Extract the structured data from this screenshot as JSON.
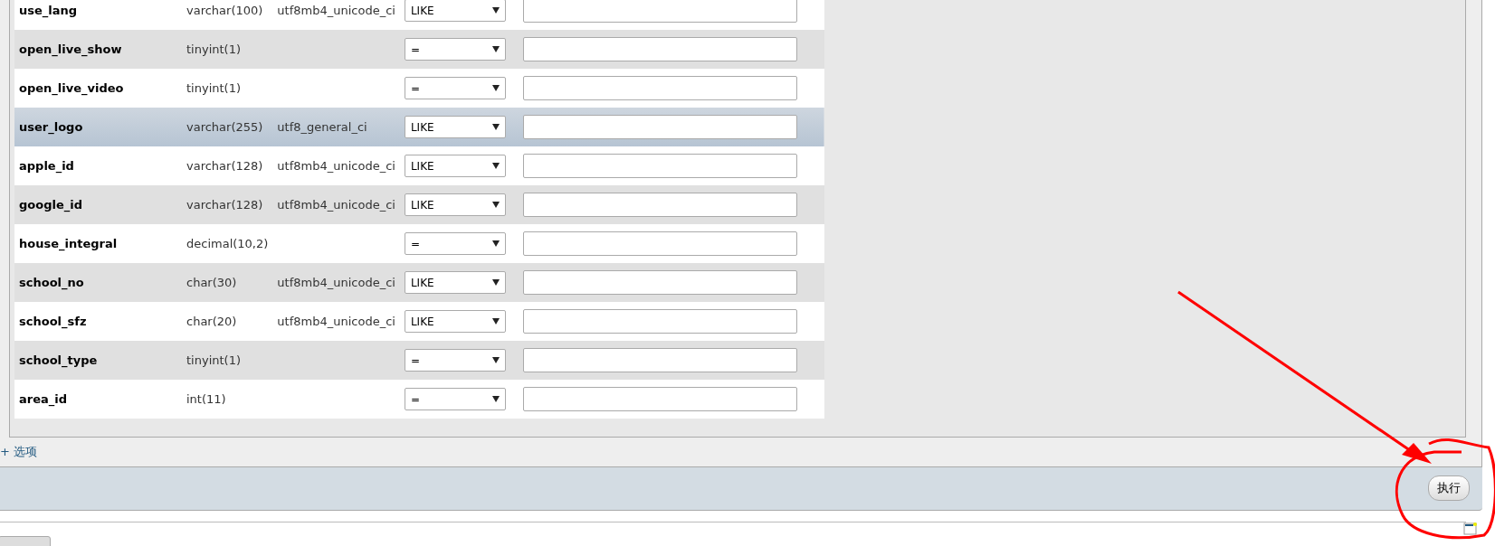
{
  "rows": [
    {
      "column": "use_lang",
      "type": "varchar(100)",
      "collation": "utf8mb4_unicode_ci",
      "operator": "LIKE",
      "highlighted": false
    },
    {
      "column": "open_live_show",
      "type": "tinyint(1)",
      "operator": "=",
      "highlighted": false
    },
    {
      "column": "open_live_video",
      "type": "tinyint(1)",
      "operator": "=",
      "highlighted": false
    },
    {
      "column": "user_logo",
      "type": "varchar(255)",
      "collation": "utf8_general_ci",
      "operator": "LIKE",
      "highlighted": true
    },
    {
      "column": "apple_id",
      "type": "varchar(128)",
      "collation": "utf8mb4_unicode_ci",
      "operator": "LIKE",
      "highlighted": false
    },
    {
      "column": "google_id",
      "type": "varchar(128)",
      "collation": "utf8mb4_unicode_ci",
      "operator": "LIKE",
      "highlighted": false
    },
    {
      "column": "house_integral",
      "type": "decimal(10,2)",
      "operator": "=",
      "highlighted": false
    },
    {
      "column": "school_no",
      "type": "char(30)",
      "collation": "utf8mb4_unicode_ci",
      "operator": "LIKE",
      "highlighted": false
    },
    {
      "column": "school_sfz",
      "type": "char(20)",
      "collation": "utf8mb4_unicode_ci",
      "operator": "LIKE",
      "highlighted": false
    },
    {
      "column": "school_type",
      "type": "tinyint(1)",
      "operator": "=",
      "highlighted": false
    },
    {
      "column": "area_id",
      "type": "int(11)",
      "operator": "=",
      "highlighted": false
    }
  ],
  "options_toggle": {
    "icon": "+",
    "label": "选项"
  },
  "submit_button": "执行",
  "annotations": {
    "arrow": true,
    "circle": true
  }
}
